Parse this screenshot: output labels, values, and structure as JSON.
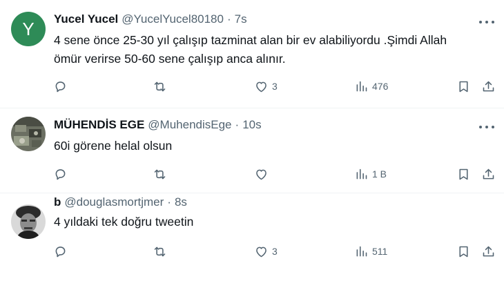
{
  "tweets": [
    {
      "avatar_letter": "Y",
      "avatar_color": "#2e8b57",
      "display_name": "Yucel Yucel",
      "handle": "@YucelYucel80180",
      "separator": "·",
      "time": "7s",
      "text_lines": [
        "4 sene önce 25-30 yıl çalışıp tazminat alan bir ev alabiliyordu .Şimdi Allah",
        "ömür verirse 50-60 sene çalışıp anca alınır."
      ],
      "likes": "3",
      "views": "476"
    },
    {
      "avatar_image": "photo-avatar",
      "display_name": "MÜHENDİS EGE",
      "handle": "@MuhendisEge",
      "separator": "·",
      "time": "10s",
      "text_lines": [
        "60i görene helal olsun"
      ],
      "likes": "",
      "views": "1 B"
    },
    {
      "avatar_image": "portrait-avatar",
      "display_name": "b",
      "handle": "@douglasmortjmer",
      "separator": "·",
      "time": "8s",
      "text_lines": [
        "4 yıldaki tek doğru tweetin"
      ],
      "likes": "3",
      "views": "511"
    }
  ],
  "icons": [
    "reply-icon",
    "retweet-icon",
    "like-icon",
    "views-icon",
    "bookmark-icon",
    "share-icon",
    "more-icon"
  ]
}
